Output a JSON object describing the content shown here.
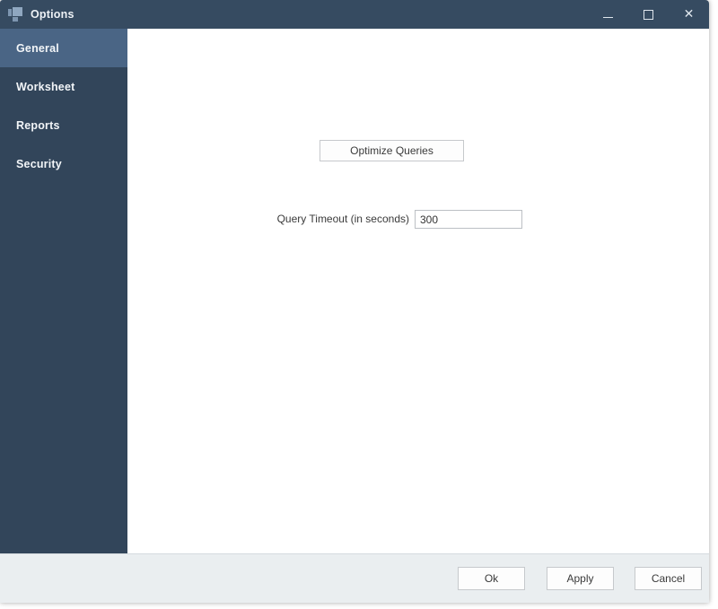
{
  "window": {
    "title": "Options",
    "icon": "app-squares-icon",
    "colors": {
      "titlebar": "#364b61",
      "sidebar": "#32455a",
      "sidebar_selected": "#4a6585",
      "footer": "#eaeef0",
      "content": "#ffffff"
    },
    "controls": {
      "minimize": "─",
      "maximize": "□",
      "close": "✕"
    }
  },
  "sidebar": {
    "items": [
      {
        "label": "General",
        "selected": true
      },
      {
        "label": "Worksheet",
        "selected": false
      },
      {
        "label": "Reports",
        "selected": false
      },
      {
        "label": "Security",
        "selected": false
      }
    ]
  },
  "content": {
    "optimize_button_label": "Optimize Queries",
    "query_timeout": {
      "label": "Query Timeout (in seconds)",
      "value": "300",
      "placeholder": ""
    }
  },
  "footer": {
    "ok_label": "Ok",
    "apply_label": "Apply",
    "cancel_label": "Cancel"
  }
}
